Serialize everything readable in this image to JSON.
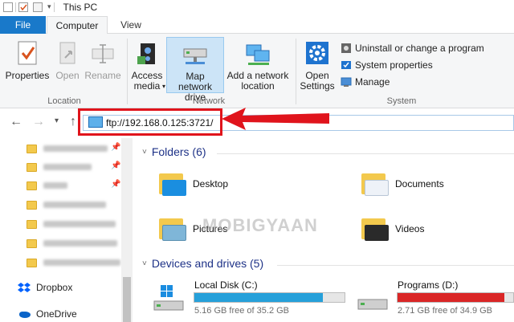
{
  "window": {
    "title": "This PC"
  },
  "ribbon_tabs": {
    "file": "File",
    "computer": "Computer",
    "view": "View"
  },
  "ribbon": {
    "properties": "Properties",
    "open": "Open",
    "rename": "Rename",
    "location_group": "Location",
    "access_media": "Access media",
    "map_network_drive": "Map network drive",
    "add_network_location": "Add a network location",
    "network_group": "Network",
    "open_settings": "Open Settings",
    "uninstall": "Uninstall or change a program",
    "system_properties": "System properties",
    "manage": "Manage",
    "system_group": "System"
  },
  "address_bar": {
    "value": "ftp://192.168.0.125:3721/"
  },
  "nav_pane": {
    "quick_access_count": 7,
    "dropbox": "Dropbox",
    "onedrive": "OneDrive"
  },
  "content": {
    "folders_header": "Folders (6)",
    "folders": [
      {
        "name": "Desktop"
      },
      {
        "name": "Documents"
      },
      {
        "name": "Pictures"
      },
      {
        "name": "Videos"
      }
    ],
    "devices_header": "Devices and drives (5)",
    "drives": [
      {
        "name": "Local Disk (C:)",
        "free": "5.16 GB free of 35.2 GB",
        "used_fraction": 0.853,
        "bar_color": "#26a0da"
      },
      {
        "name": "Programs (D:)",
        "free": "2.71 GB free of 34.9 GB",
        "used_fraction": 0.922,
        "bar_color": "#da2626"
      }
    ]
  },
  "watermark": "MOBIGYAAN",
  "colors": {
    "accent": "#1979ca",
    "annotation_red": "#e0141c"
  }
}
